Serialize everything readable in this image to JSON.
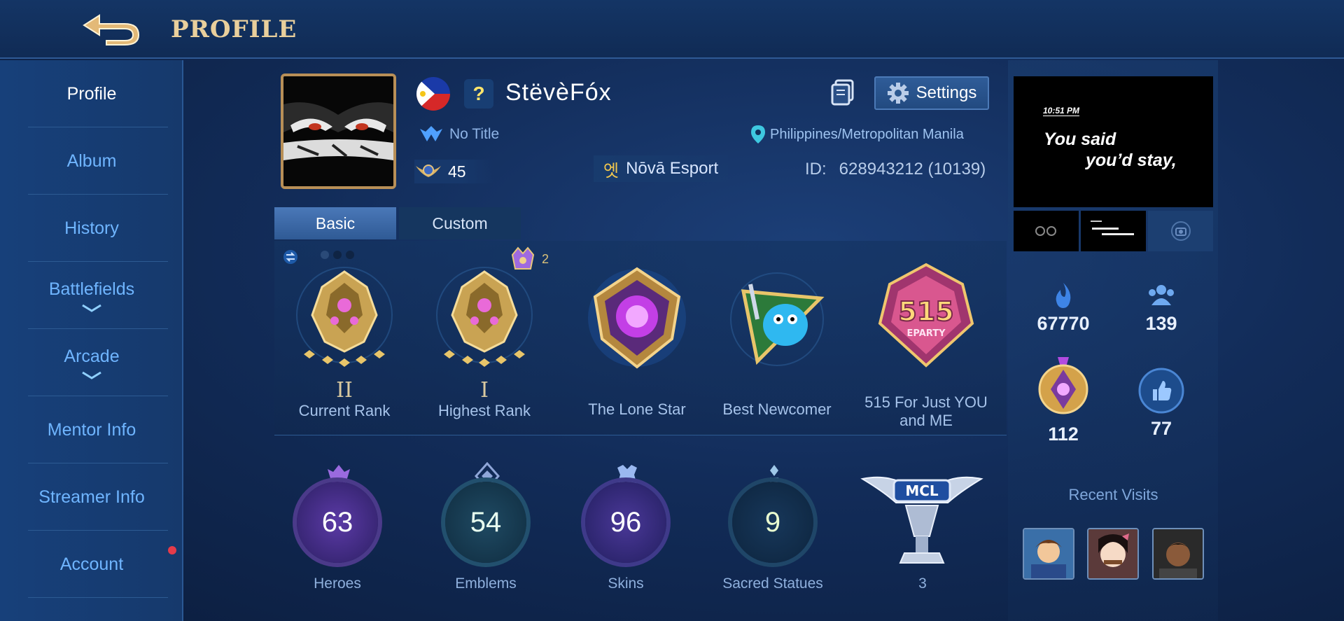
{
  "header": {
    "title": "PROFILE"
  },
  "sidebar": {
    "items": [
      {
        "label": "Profile"
      },
      {
        "label": "Album"
      },
      {
        "label": "History"
      },
      {
        "label": "Battlefields"
      },
      {
        "label": "Arcade"
      },
      {
        "label": "Mentor Info"
      },
      {
        "label": "Streamer Info"
      },
      {
        "label": "Account"
      }
    ]
  },
  "profile": {
    "name": "StëvèFóx",
    "badge": "?",
    "title": "No Title",
    "level": "45",
    "squad": "Nōvā Esport",
    "squad_icon": "엣",
    "location": "Philippines/Metropolitan Manila",
    "id_label": "ID:",
    "id_value": "628943212 (10139)",
    "settings_label": "Settings"
  },
  "tabs": [
    {
      "label": "Basic",
      "active": true
    },
    {
      "label": "Custom",
      "active": false
    }
  ],
  "achievements": {
    "peak_count": "2",
    "medals": [
      {
        "label": "Current Rank",
        "roman": "II"
      },
      {
        "label": "Highest Rank",
        "roman": "I"
      },
      {
        "label": "The Lone Star"
      },
      {
        "label": "Best Newcomer"
      },
      {
        "label": "515 For Just YOU and ME",
        "badge_text": "515",
        "badge_sub": "EPARTY"
      }
    ]
  },
  "stats": [
    {
      "label": "Heroes",
      "value": "63"
    },
    {
      "label": "Emblems",
      "value": "54"
    },
    {
      "label": "Skins",
      "value": "96"
    },
    {
      "label": "Sacred Statues",
      "value": "9"
    },
    {
      "label": "3",
      "badge": "MCL"
    }
  ],
  "right": {
    "status_time": "10:51 PM",
    "status_line1": "You said",
    "status_line2": "you’d stay,",
    "popularity": "67770",
    "followers": "139",
    "charm": "112",
    "likes": "77",
    "recent_visits_label": "Recent Visits"
  },
  "colors": {
    "accent_gold": "#e9cf9c",
    "sidebar_text": "#6fb5ff",
    "hero_ring": "#6a3fb0",
    "emblem_ring": "#2a5f8e"
  }
}
